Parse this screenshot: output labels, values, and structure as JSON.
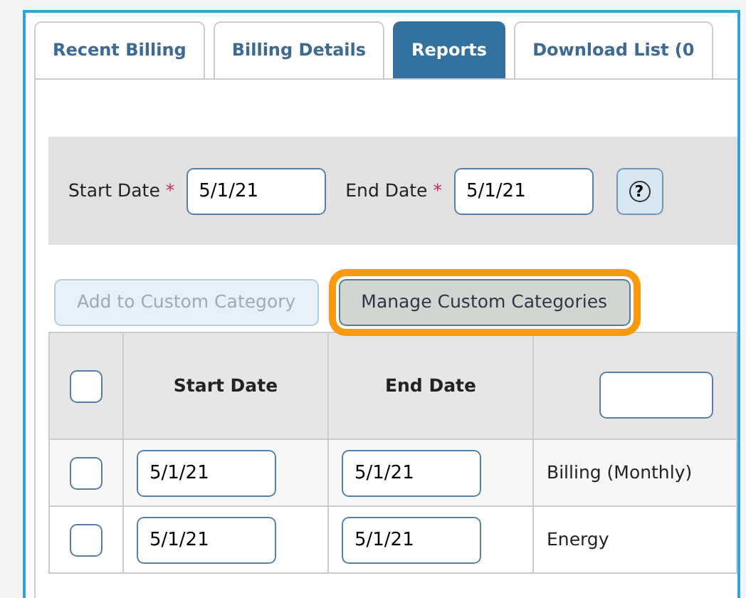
{
  "tabs": [
    {
      "label": "Recent Billing",
      "selected": false
    },
    {
      "label": "Billing Details",
      "selected": false
    },
    {
      "label": "Reports",
      "selected": true
    },
    {
      "label": "Download List (0",
      "selected": false
    }
  ],
  "filter": {
    "fields": [
      {
        "label": "Start Date",
        "required_mark": "*",
        "value": "5/1/21"
      },
      {
        "label": "End Date",
        "required_mark": "*",
        "value": "5/1/21"
      }
    ],
    "help_button": "?"
  },
  "buttons": [
    {
      "label": "Add to Custom Category",
      "disabled": true,
      "highlighted": false
    },
    {
      "label": "Manage Custom Categories",
      "disabled": false,
      "highlighted": true
    }
  ],
  "table": {
    "select_all": {
      "checked": false
    },
    "columns": [
      "Start Date",
      "End Date"
    ],
    "rows": [
      {
        "checked": false,
        "start_date": "5/1/21",
        "end_date": "5/1/21",
        "column_3": "Billing (Monthly)"
      },
      {
        "checked": false,
        "start_date": "5/1/21",
        "end_date": "5/1/21",
        "column_3": "Energy"
      }
    ]
  }
}
